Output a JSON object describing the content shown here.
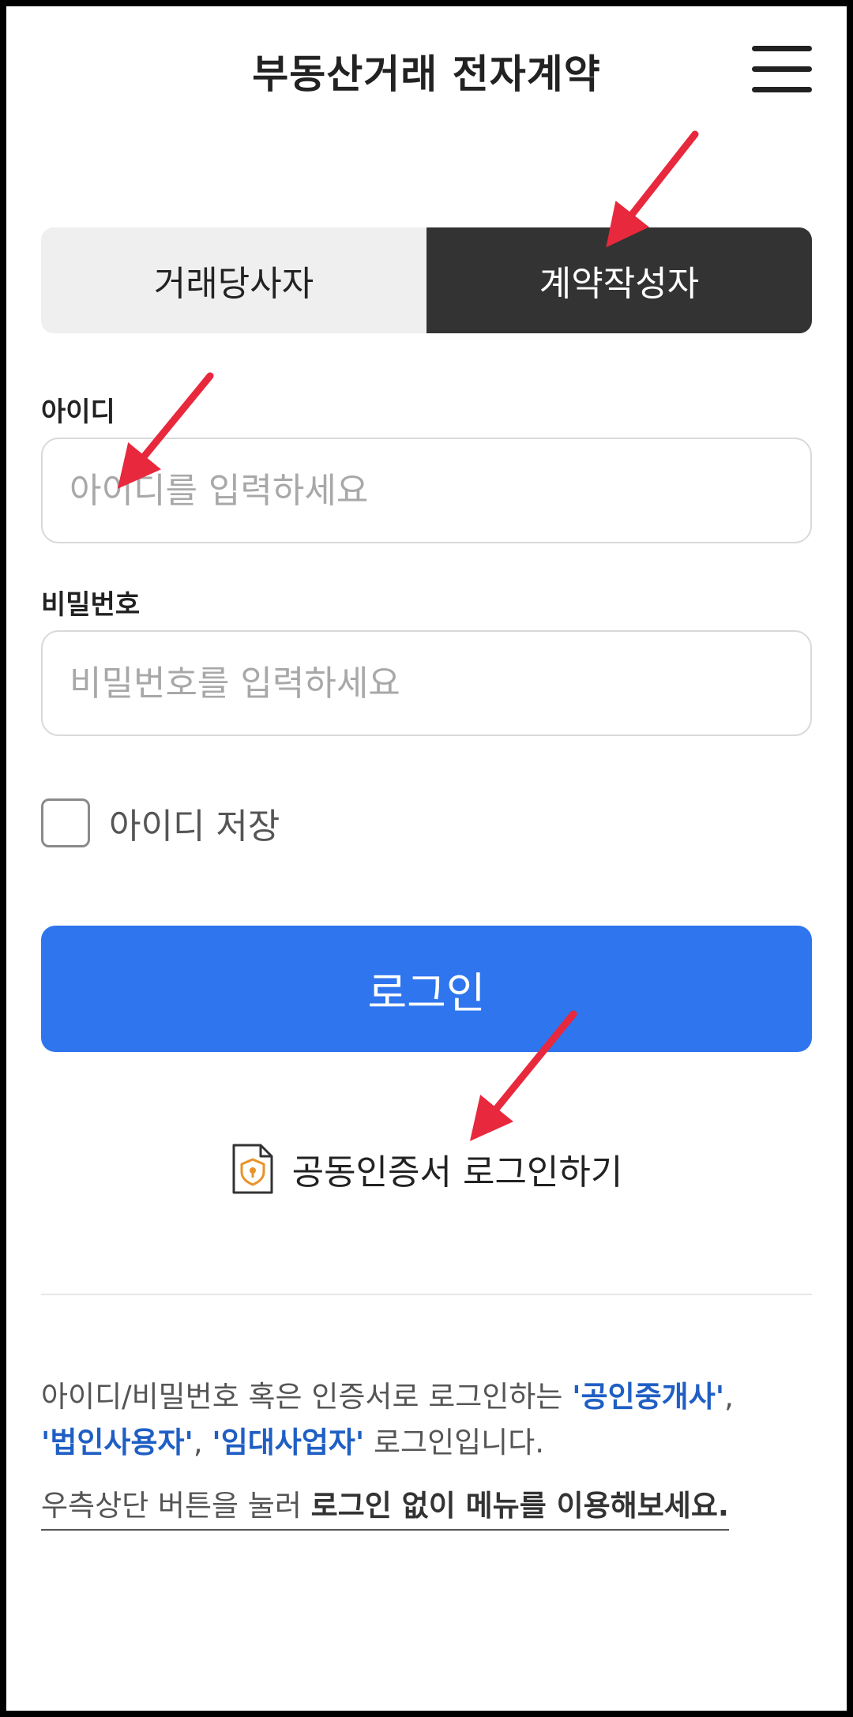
{
  "header": {
    "title": "부동산거래 전자계약",
    "menu_icon": "hamburger-menu-icon"
  },
  "tabs": [
    {
      "label": "거래당사자",
      "selected": false
    },
    {
      "label": "계약작성자",
      "selected": true
    }
  ],
  "form": {
    "id_label": "아이디",
    "id_placeholder": "아이디를 입력하세요",
    "id_value": "",
    "password_label": "비밀번호",
    "password_placeholder": "비밀번호를 입력하세요",
    "password_value": "",
    "remember_label": "아이디 저장",
    "remember_checked": false,
    "login_label": "로그인",
    "cert_icon": "certificate-lock-icon",
    "cert_login_label": "공동인증서 로그인하기"
  },
  "info": {
    "line1_prefix": "아이디/비밀번호 혹은 인증서로 로그인하는 ",
    "hl1": "'공인중개사'",
    "sep1": ",",
    "hl2": "'법인사용자'",
    "sep2": ", ",
    "hl3": "'임대사업자'",
    "suffix": " 로그인입니다.",
    "hint_prefix": "우측상단 버튼을 눌러 ",
    "hint_bold": "로그인 없이 메뉴를 이용해보세요."
  },
  "colors": {
    "primary": "#2e75ee",
    "active_tab": "#333333",
    "highlight": "#1f5fc4",
    "annotation_arrow": "#e8283c"
  }
}
